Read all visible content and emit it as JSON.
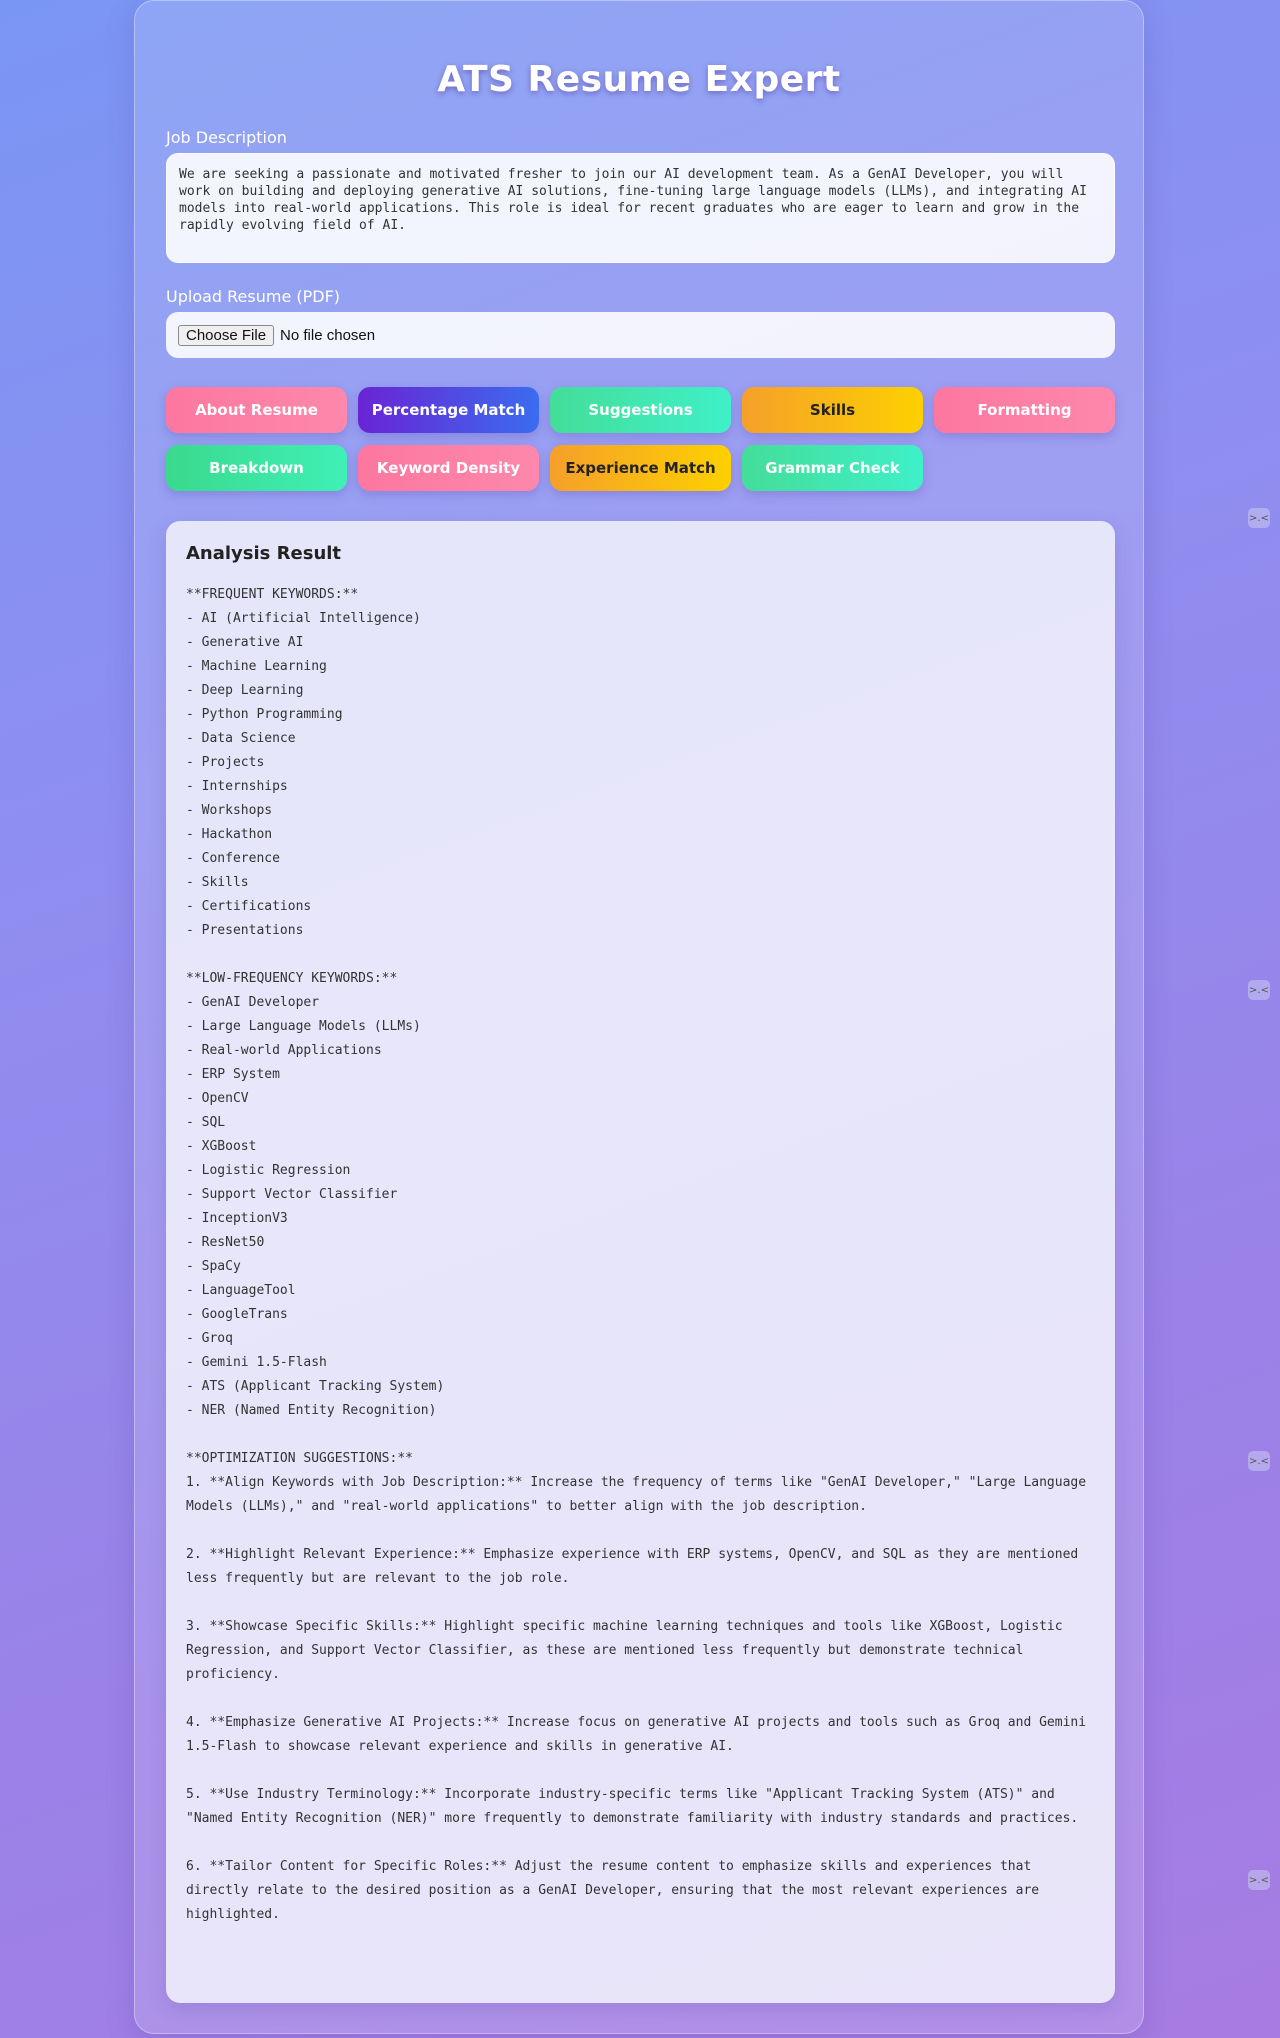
{
  "app": {
    "title": "ATS Resume Expert"
  },
  "job_description": {
    "label": "Job Description",
    "value": "We are seeking a passionate and motivated fresher to join our AI development team. As a GenAI Developer, you will work on building and deploying generative AI solutions, fine-tuning large language models (LLMs), and integrating AI models into real-world applications. This role is ideal for recent graduates who are eager to learn and grow in the rapidly evolving field of AI."
  },
  "upload": {
    "label": "Upload Resume (PDF)",
    "button_label": "Choose File",
    "status": "No file chosen"
  },
  "actions": [
    {
      "label": "About Resume",
      "style": "pink"
    },
    {
      "label": "Percentage Match",
      "style": "blue"
    },
    {
      "label": "Suggestions",
      "style": "mint"
    },
    {
      "label": "Skills",
      "style": "orange"
    },
    {
      "label": "Formatting",
      "style": "pink"
    },
    {
      "label": "Breakdown",
      "style": "green"
    },
    {
      "label": "Keyword Density",
      "style": "pink"
    },
    {
      "label": "Experience Match",
      "style": "orange"
    },
    {
      "label": "Grammar Check",
      "style": "mint"
    }
  ],
  "result": {
    "heading": "Analysis Result",
    "text": "**FREQUENT KEYWORDS:**\n- AI (Artificial Intelligence)\n- Generative AI\n- Machine Learning\n- Deep Learning\n- Python Programming\n- Data Science\n- Projects\n- Internships\n- Workshops\n- Hackathon\n- Conference\n- Skills\n- Certifications\n- Presentations\n\n**LOW-FREQUENCY KEYWORDS:**\n- GenAI Developer\n- Large Language Models (LLMs)\n- Real-world Applications\n- ERP System\n- OpenCV\n- SQL\n- XGBoost\n- Logistic Regression\n- Support Vector Classifier\n- InceptionV3\n- ResNet50\n- SpaCy\n- LanguageTool\n- GoogleTrans\n- Groq\n- Gemini 1.5-Flash\n- ATS (Applicant Tracking System)\n- NER (Named Entity Recognition)\n\n**OPTIMIZATION SUGGESTIONS:**\n1. **Align Keywords with Job Description:** Increase the frequency of terms like \"GenAI Developer,\" \"Large Language Models (LLMs),\" and \"real-world applications\" to better align with the job description.\n\n2. **Highlight Relevant Experience:** Emphasize experience with ERP systems, OpenCV, and SQL as they are mentioned less frequently but are relevant to the job role.\n\n3. **Showcase Specific Skills:** Highlight specific machine learning techniques and tools like XGBoost, Logistic Regression, and Support Vector Classifier, as these are mentioned less frequently but demonstrate technical proficiency.\n\n4. **Emphasize Generative AI Projects:** Increase focus on generative AI projects and tools such as Groq and Gemini 1.5-Flash to showcase relevant experience and skills in generative AI.\n\n5. **Use Industry Terminology:** Incorporate industry-specific terms like \"Applicant Tracking System (ATS)\" and \"Named Entity Recognition (NER)\" more frequently to demonstrate familiarity with industry standards and practices.\n\n6. **Tailor Content for Specific Roles:** Adjust the resume content to emphasize skills and experiences that directly relate to the desired position as a GenAI Developer, ensuring that the most relevant experiences are highlighted."
  },
  "side_icons": [
    {
      "name": "floating-widget-icon",
      "glyph": ">.<"
    },
    {
      "name": "floating-widget-icon",
      "glyph": ">.<"
    },
    {
      "name": "floating-widget-icon",
      "glyph": ">.<"
    },
    {
      "name": "floating-widget-icon",
      "glyph": ">.<"
    }
  ],
  "colors": {
    "pink": "#fd77a0",
    "blue": "#6a24d4",
    "mint": "#3ff0c8",
    "green": "#3ad98d",
    "orange": "#f5a02a"
  }
}
